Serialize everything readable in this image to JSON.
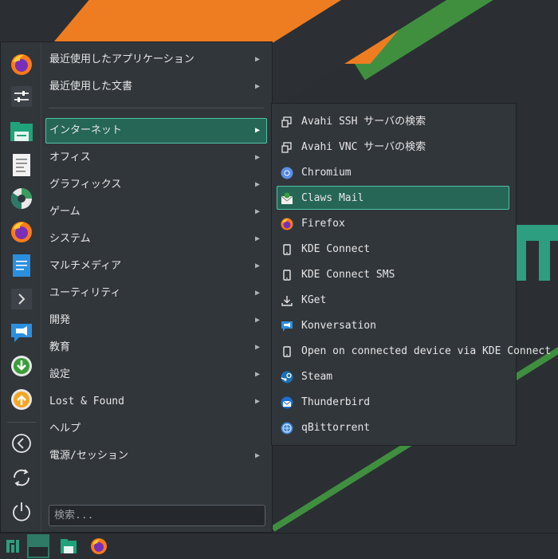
{
  "favorites": [
    {
      "name": "firefox-icon"
    },
    {
      "name": "settings-sliders-icon"
    },
    {
      "name": "file-manager-icon"
    },
    {
      "name": "text-editor-icon"
    },
    {
      "name": "disk-usage-icon"
    },
    {
      "name": "firefox-icon"
    },
    {
      "name": "document-writer-icon"
    },
    {
      "name": "terminal-icon"
    },
    {
      "name": "konversation-icon"
    },
    {
      "name": "download-icon"
    },
    {
      "name": "upload-icon"
    }
  ],
  "categories_top": [
    {
      "label": "最近使用したアプリケーション"
    },
    {
      "label": "最近使用した文書"
    }
  ],
  "categories": [
    {
      "label": "インターネット",
      "selected": true
    },
    {
      "label": "オフィス"
    },
    {
      "label": "グラフィックス"
    },
    {
      "label": "ゲーム"
    },
    {
      "label": "システム"
    },
    {
      "label": "マルチメディア"
    },
    {
      "label": "ユーティリティ"
    },
    {
      "label": "開発"
    },
    {
      "label": "教育"
    },
    {
      "label": "設定"
    },
    {
      "label": "Lost & Found"
    },
    {
      "label": "ヘルプ",
      "no_arrow": true
    },
    {
      "label": "電源/セッション"
    }
  ],
  "search": {
    "placeholder": "検索..."
  },
  "submenu": [
    {
      "label": "Avahi SSH サーバの検索",
      "icon": "remote-desktop-icon"
    },
    {
      "label": "Avahi VNC サーバの検索",
      "icon": "remote-desktop-icon"
    },
    {
      "label": "Chromium",
      "icon": "chromium-icon"
    },
    {
      "label": "Claws Mail",
      "icon": "claws-mail-icon",
      "selected": true
    },
    {
      "label": "Firefox",
      "icon": "firefox-icon"
    },
    {
      "label": "KDE Connect",
      "icon": "phone-icon"
    },
    {
      "label": "KDE Connect SMS",
      "icon": "phone-icon"
    },
    {
      "label": "KGet",
      "icon": "kget-download-icon"
    },
    {
      "label": "Konversation",
      "icon": "konversation-icon"
    },
    {
      "label": "Open on connected device via KDE Connect",
      "icon": "phone-icon"
    },
    {
      "label": "Steam",
      "icon": "steam-icon"
    },
    {
      "label": "Thunderbird",
      "icon": "thunderbird-icon"
    },
    {
      "label": "qBittorrent",
      "icon": "qbittorrent-icon"
    }
  ],
  "taskbar": [
    {
      "name": "manjaro-menu-icon"
    },
    {
      "name": "desktop-pager-icon"
    },
    {
      "name": "file-manager-icon"
    },
    {
      "name": "firefox-icon"
    }
  ],
  "colors": {
    "accent": "#266657",
    "accent_border": "#4fc3a8",
    "panel": "#31363b"
  }
}
